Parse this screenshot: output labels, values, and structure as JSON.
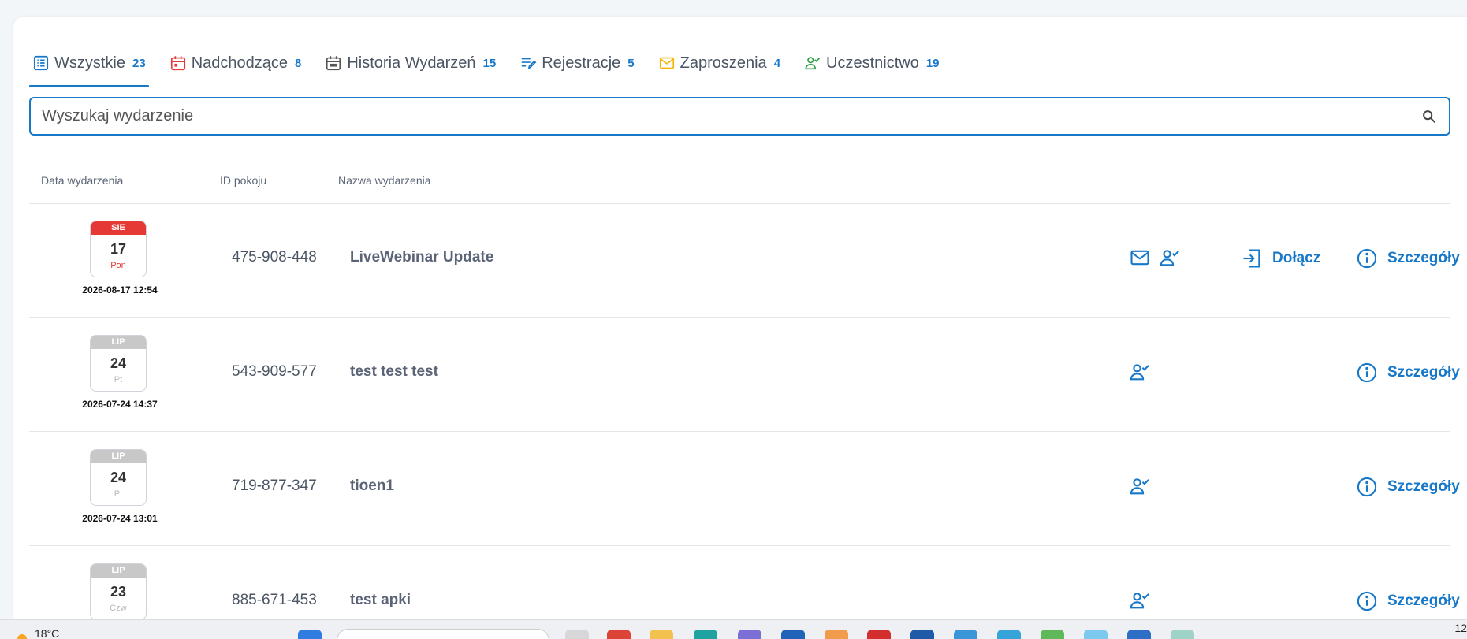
{
  "tabs": [
    {
      "label": "Wszystkie",
      "count": "23",
      "icon": "list-icon"
    },
    {
      "label": "Nadchodzące",
      "count": "8",
      "icon": "calendar-icon"
    },
    {
      "label": "Historia Wydarzeń",
      "count": "15",
      "icon": "calendar-history-icon"
    },
    {
      "label": "Rejestracje",
      "count": "5",
      "icon": "registration-icon"
    },
    {
      "label": "Zaproszenia",
      "count": "4",
      "icon": "envelope-icon"
    },
    {
      "label": "Uczestnictwo",
      "count": "19",
      "icon": "user-check-icon"
    }
  ],
  "search": {
    "placeholder": "Wyszukaj wydarzenie",
    "value": ""
  },
  "table": {
    "headers": {
      "date": "Data wydarzenia",
      "room": "ID pokoju",
      "name": "Nazwa wydarzenia"
    },
    "rows": [
      {
        "month": "SIE",
        "day": "17",
        "weekday": "Pon",
        "datetime": "2026-08-17 12:54",
        "room": "475-908-448",
        "name": "LiveWebinar Update",
        "join": "Dołącz",
        "details": "Szczegóły"
      },
      {
        "month": "LIP",
        "day": "24",
        "weekday": "Pt",
        "datetime": "2026-07-24 14:37",
        "room": "543-909-577",
        "name": "test test test",
        "details": "Szczegóły"
      },
      {
        "month": "LIP",
        "day": "24",
        "weekday": "Pt",
        "datetime": "2026-07-24 13:01",
        "room": "719-877-347",
        "name": "tioen1",
        "details": "Szczegóły"
      },
      {
        "month": "LIP",
        "day": "23",
        "weekday": "Czw",
        "room": "885-671-453",
        "name": "test apki",
        "details": "Szczegóły"
      }
    ]
  },
  "taskbar": {
    "temperature": "18°C",
    "clock": "12"
  },
  "colors": {
    "accent": "#1778c9",
    "upcoming": "#e53935",
    "past": "#c8c8c8",
    "invite": "#f4b400",
    "attend": "#2e9e44"
  }
}
